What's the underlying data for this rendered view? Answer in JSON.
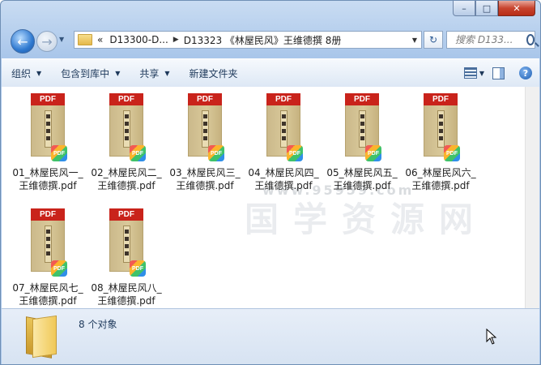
{
  "window": {
    "minimize_glyph": "–",
    "maximize_glyph": "□",
    "close_glyph": "✕"
  },
  "nav": {
    "back_glyph": "←",
    "forward_glyph": "→",
    "history_glyph": "▼"
  },
  "address": {
    "overflow_glyph": "«",
    "crumbs": [
      "D13300-D...",
      "D13323 《林屋民风》王维德撰 8册"
    ],
    "separator": "▶",
    "dropdown_glyph": "▼",
    "refresh_glyph": "↻"
  },
  "search": {
    "placeholder": "搜索 D133..."
  },
  "toolbar": {
    "organize": "组织",
    "include_in_library": "包含到库中",
    "share": "共享",
    "new_folder": "新建文件夹",
    "dropdown_glyph": "▼",
    "help_glyph": "?"
  },
  "files": [
    {
      "line1": "01_林屋民风一_",
      "line2": "王维德撰.pdf"
    },
    {
      "line1": "02_林屋民风二_",
      "line2": "王维德撰.pdf"
    },
    {
      "line1": "03_林屋民风三_",
      "line2": "王维德撰.pdf"
    },
    {
      "line1": "04_林屋民风四_",
      "line2": "王维德撰.pdf"
    },
    {
      "line1": "05_林屋民风五_",
      "line2": "王维德撰.pdf"
    },
    {
      "line1": "06_林屋民风六_",
      "line2": "王维德撰.pdf"
    },
    {
      "line1": "07_林屋民风七_",
      "line2": "王维德撰.pdf"
    },
    {
      "line1": "08_林屋民风八_",
      "line2": "王维德撰.pdf"
    }
  ],
  "thumbnail": {
    "band_label": "PDF",
    "badge_label": "PDF"
  },
  "watermark": {
    "text": "国学资源网",
    "url": "www.95959.com"
  },
  "status": {
    "count_text": "8 个对象"
  },
  "colors": {
    "pdf_band": "#c9231b",
    "chrome_blue": "#b9d1ee",
    "close_red": "#c8442f"
  }
}
